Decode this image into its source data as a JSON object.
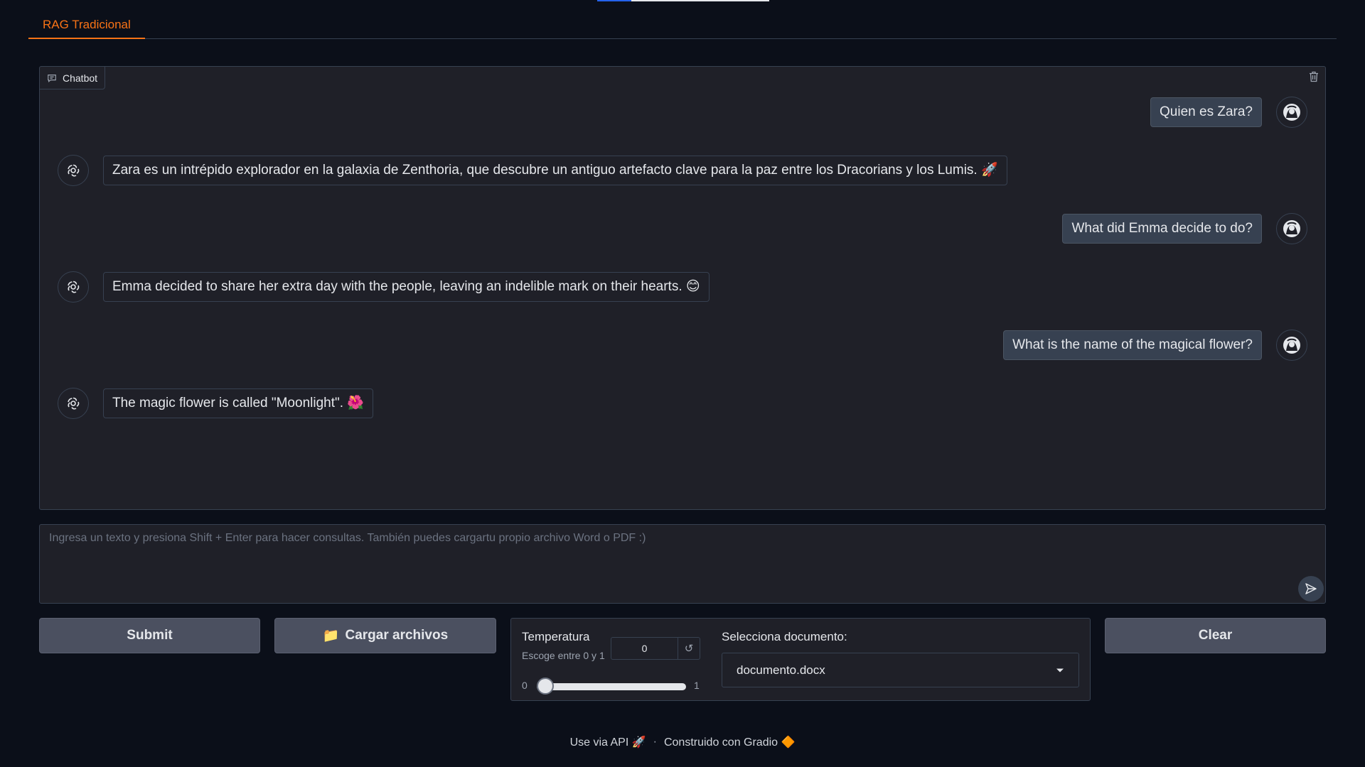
{
  "tabs": [
    {
      "label": "RAG Tradicional",
      "active": true
    }
  ],
  "chatbot": {
    "label": "Chatbot",
    "messages": [
      {
        "role": "user",
        "text": "Quien es Zara?"
      },
      {
        "role": "bot",
        "text": "Zara es un intrépido explorador en la galaxia de Zenthoria, que descubre un antiguo artefacto clave para la paz entre los Dracorians y los Lumis. 🚀"
      },
      {
        "role": "user",
        "text": "What did Emma decide to do?"
      },
      {
        "role": "bot",
        "text": "Emma decided to share her extra day with the people, leaving an indelible mark on their hearts. 😊"
      },
      {
        "role": "user",
        "text": "What is the name of the magical flower?"
      },
      {
        "role": "bot",
        "text": "The magic flower is called \"Moonlight\". 🌺"
      }
    ]
  },
  "input": {
    "placeholder": "Ingresa un texto y presiona Shift + Enter para hacer consultas. También puedes cargartu propio archivo Word o PDF :)",
    "value": ""
  },
  "buttons": {
    "submit": "Submit",
    "upload_icon": "📁",
    "upload": "Cargar archivos",
    "clear": "Clear"
  },
  "temperature": {
    "label": "Temperatura",
    "info": "Escoge entre 0 y 1",
    "value": "0",
    "reset_icon": "↺",
    "min": "0",
    "max": "1",
    "level": 0
  },
  "document": {
    "label": "Selecciona documento:",
    "selected": "documento.docx"
  },
  "footer": {
    "api": "Use via API",
    "api_icon": "🚀",
    "separator": "·",
    "built": "Construido con Gradio",
    "gradio_icon": "🔶"
  },
  "colors": {
    "background": "#0b0f19",
    "panel": "#1f2028",
    "accent": "#f97316",
    "border": "#374151",
    "button": "#4b5060"
  }
}
